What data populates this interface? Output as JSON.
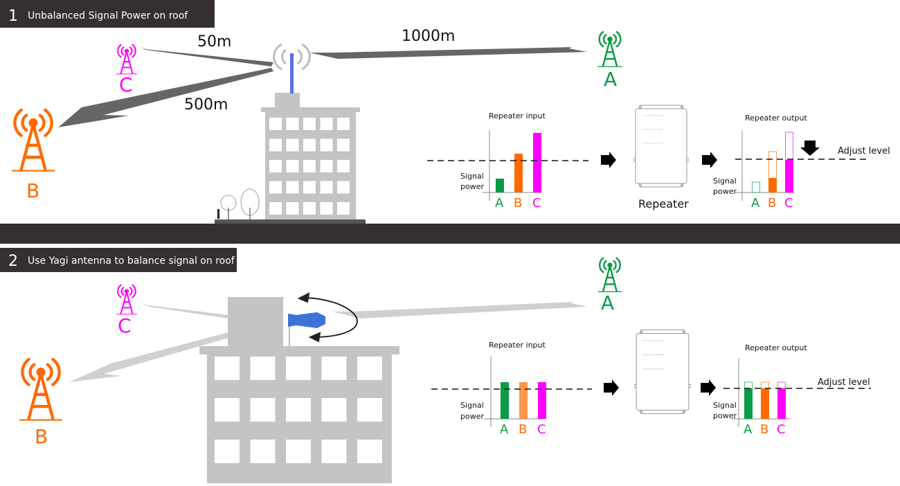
{
  "colors": {
    "A": "#0a9b45",
    "B": "#ff6a00",
    "C": "#ff00ff",
    "band": "#35302f",
    "building": "#c4c4c4",
    "antenna": "#5b6fe6"
  },
  "section1": {
    "number": "1",
    "title": "Unbalanced Signal Power on roof",
    "distances": {
      "to_c": "50m",
      "to_b": "500m",
      "to_a": "1000m"
    },
    "towers": {
      "a": "A",
      "b": "B",
      "c": "C"
    },
    "input_chart": {
      "title": "Repeater input",
      "ylabel_1": "Signal",
      "ylabel_2": "power",
      "categories": [
        "A",
        "B",
        "C"
      ],
      "levels": [
        20,
        56,
        86
      ],
      "reference_level": 46
    },
    "repeater_label": "Repeater",
    "output_chart": {
      "title": "Repeater output",
      "ylabel_1": "Signal",
      "ylabel_2": "power",
      "categories": [
        "A",
        "B",
        "C"
      ],
      "input_levels": [
        15,
        59,
        87
      ],
      "output_levels": [
        0,
        21,
        47
      ],
      "adjust_label": "Adjust level",
      "adjust_level": 48
    }
  },
  "section2": {
    "number": "2",
    "title": "Use Yagi antenna to balance signal on roof",
    "towers": {
      "a": "A",
      "b": "B",
      "c": "C"
    },
    "input_chart": {
      "title": "Repeater input",
      "ylabel_1": "Signal",
      "ylabel_2": "power",
      "categories": [
        "A",
        "B",
        "C"
      ],
      "levels": [
        53,
        53,
        53
      ],
      "reference_level": 43
    },
    "output_chart": {
      "title": "Repeater output",
      "ylabel_1": "Signal",
      "ylabel_2": "power",
      "categories": [
        "A",
        "B",
        "C"
      ],
      "input_levels": [
        53,
        53,
        53
      ],
      "output_levels": [
        44,
        44,
        44
      ],
      "adjust_label": "Adjust level",
      "adjust_level": 44
    }
  }
}
